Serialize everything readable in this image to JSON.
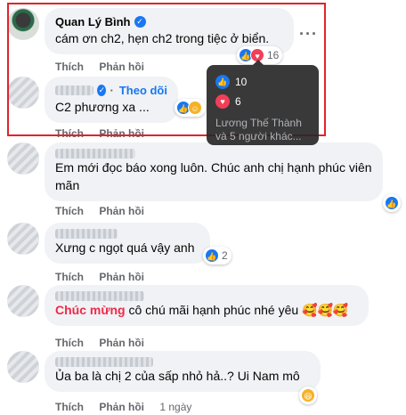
{
  "comments": [
    {
      "author": "Quan Lý Bình",
      "verified": true,
      "text": "cám ơn ch2, hẹn ch2 trong tiệc ở biển.",
      "reaction_count": "16",
      "actions": [
        "Thích",
        "Phản hồi"
      ]
    },
    {
      "author": "",
      "follow_label": "Theo dõi",
      "text": "C2 phương xa ...",
      "actions": [
        "Thích",
        "Phản hồi"
      ]
    },
    {
      "author": "",
      "text": "Em mới đọc báo xong luôn. Chúc anh chị hạnh phúc viên mãn",
      "actions": [
        "Thích",
        "Phản hồi"
      ]
    },
    {
      "author": "",
      "text": "Xưng c ngọt quá vậy anh",
      "reaction_count": "2",
      "actions": [
        "Thích",
        "Phản hồi"
      ]
    },
    {
      "author": "",
      "highlight": "Chúc mừng",
      "text": " cô chú mãi hạnh phúc nhé yêu 🥰🥰🥰",
      "actions": [
        "Thích",
        "Phản hồi"
      ]
    },
    {
      "author": "",
      "text": "Ủa ba là chị 2 của sấp nhỏ hả..? Ui Nam mô",
      "actions": [
        "Thích",
        "Phản hồi"
      ],
      "time": "1 ngày"
    }
  ],
  "tooltip": {
    "like_count": "10",
    "love_count": "6",
    "people_text": "Lương Thế Thành và 5 người khác..."
  },
  "icons": {
    "like": "like-icon",
    "love": "love-icon",
    "care": "care-icon",
    "haha": "haha-icon",
    "verified": "verified-badge-icon",
    "more": "more-options-icon"
  },
  "colors": {
    "like": "#1877f2",
    "love": "#f33e58",
    "highlight_box": "#e0242b",
    "highlight_text": "#f02849"
  }
}
